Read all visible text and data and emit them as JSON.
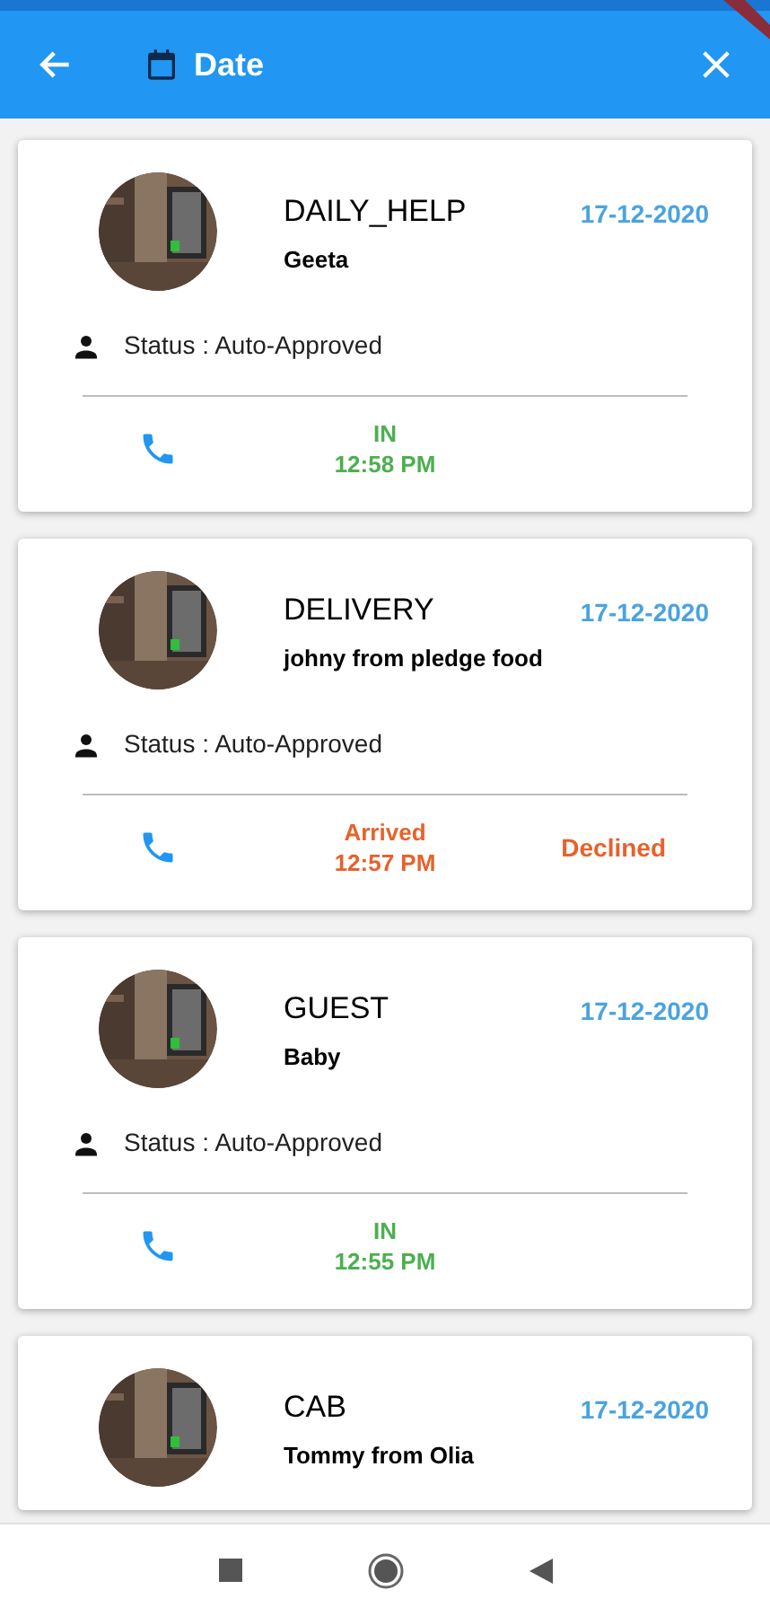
{
  "app_bar": {
    "title": "Date"
  },
  "entries": [
    {
      "category": "DAILY_HELP",
      "visitor": "Geeta",
      "date": "17-12-2020",
      "status": "Status : Auto-Approved",
      "event": {
        "label": "IN",
        "time": "12:58 PM",
        "color": "#4caf50"
      }
    },
    {
      "category": "DELIVERY",
      "visitor": "johny from pledge food",
      "date": "17-12-2020",
      "status": "Status : Auto-Approved",
      "event": {
        "label": "Arrived",
        "time": "12:57 PM",
        "color": "#e6622a"
      },
      "decision": {
        "label": "Declined",
        "color": "#e6622a"
      }
    },
    {
      "category": "GUEST",
      "visitor": "Baby",
      "date": "17-12-2020",
      "status": "Status : Auto-Approved",
      "event": {
        "label": "IN",
        "time": "12:55 PM",
        "color": "#4caf50"
      }
    },
    {
      "category": "CAB",
      "visitor": "Tommy from Olia",
      "date": "17-12-2020"
    }
  ]
}
